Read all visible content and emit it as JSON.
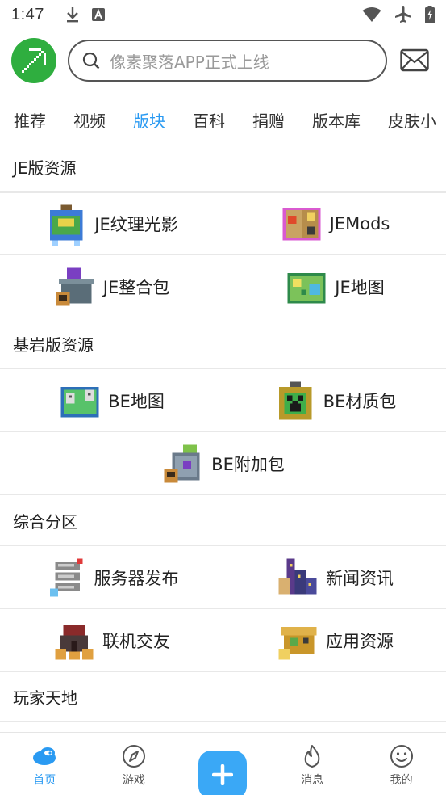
{
  "status_bar": {
    "time": "1:47"
  },
  "search": {
    "placeholder": "像素聚落APP正式上线"
  },
  "tabs": [
    "推荐",
    "视频",
    "版块",
    "百科",
    "捐赠",
    "版本库",
    "皮肤小"
  ],
  "active_tab": "版块",
  "sections": {
    "je": {
      "title": "JE版资源",
      "items": [
        "JE纹理光影",
        "JEMods",
        "JE整合包",
        "JE地图"
      ]
    },
    "be": {
      "title": "基岩版资源",
      "items": [
        "BE地图",
        "BE材质包",
        "BE附加包"
      ]
    },
    "general": {
      "title": "综合分区",
      "items": [
        "服务器发布",
        "新闻资讯",
        "联机交友",
        "应用资源"
      ]
    },
    "players": {
      "title": "玩家天地"
    }
  },
  "bottom_nav": {
    "home": "首页",
    "games": "游戏",
    "messages": "消息",
    "mine": "我的"
  },
  "colors": {
    "accent": "#2a9af2",
    "logo_green": "#2fae3f",
    "plus_button": "#3aa8f6"
  }
}
